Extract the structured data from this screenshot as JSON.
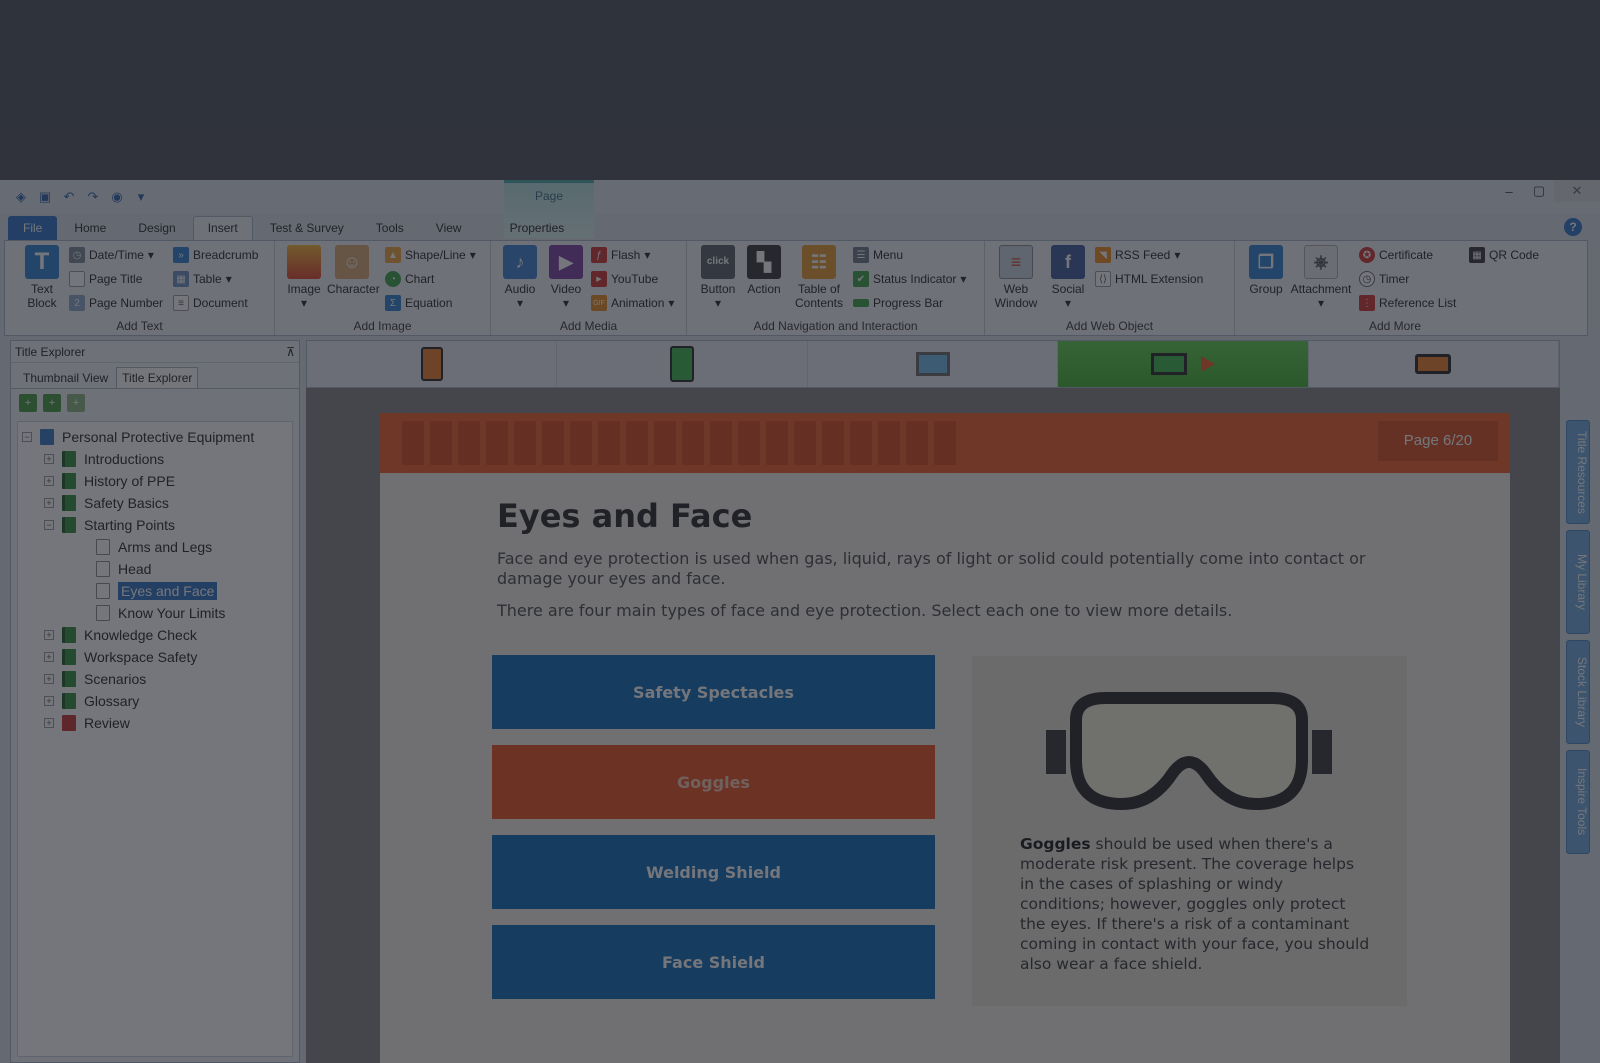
{
  "app": {
    "context_tab": "Page",
    "window_controls": {
      "minimize": "–",
      "maximize": "▢",
      "close": "✕"
    }
  },
  "tabs": [
    {
      "label": "File"
    },
    {
      "label": "Home"
    },
    {
      "label": "Design"
    },
    {
      "label": "Insert"
    },
    {
      "label": "Test & Survey"
    },
    {
      "label": "Tools"
    },
    {
      "label": "View"
    },
    {
      "label": "Properties"
    }
  ],
  "ribbon": {
    "add_text": {
      "group_label": "Add Text",
      "text_block": "Text Block",
      "date_time": "Date/Time",
      "page_title": "Page Title",
      "page_number": "Page Number",
      "breadcrumb": "Breadcrumb",
      "table": "Table",
      "document": "Document"
    },
    "add_image": {
      "group_label": "Add Image",
      "image": "Image",
      "character": "Character",
      "shape_line": "Shape/Line",
      "chart": "Chart",
      "equation": "Equation"
    },
    "add_media": {
      "group_label": "Add Media",
      "audio": "Audio",
      "video": "Video",
      "flash": "Flash",
      "youtube": "YouTube",
      "animation": "Animation"
    },
    "add_nav": {
      "group_label": "Add Navigation and Interaction",
      "button": "Button",
      "action": "Action",
      "toc": "Table of Contents",
      "menu": "Menu",
      "status_indicator": "Status Indicator",
      "progress_bar": "Progress Bar"
    },
    "add_web": {
      "group_label": "Add Web Object",
      "web_window": "Web Window",
      "social": "Social",
      "rss_feed": "RSS Feed",
      "html_extension": "HTML Extension"
    },
    "add_more": {
      "group_label": "Add More",
      "group": "Group",
      "attachment": "Attachment",
      "certificate": "Certificate",
      "timer": "Timer",
      "reference_list": "Reference List",
      "qr_code": "QR Code"
    }
  },
  "explorer": {
    "title": "Title Explorer",
    "pin": "⊼",
    "tabs": [
      "Thumbnail View",
      "Title Explorer"
    ],
    "tree": [
      {
        "label": "Personal Protective Equipment",
        "level": 0,
        "type": "root",
        "exp": "−"
      },
      {
        "label": "Introductions",
        "level": 1,
        "type": "book",
        "exp": "+"
      },
      {
        "label": "History of PPE",
        "level": 1,
        "type": "book",
        "exp": "+"
      },
      {
        "label": "Safety Basics",
        "level": 1,
        "type": "book",
        "exp": "+"
      },
      {
        "label": "Starting Points",
        "level": 1,
        "type": "book",
        "exp": "−"
      },
      {
        "label": "Arms and Legs",
        "level": 2,
        "type": "page"
      },
      {
        "label": "Head",
        "level": 2,
        "type": "page"
      },
      {
        "label": "Eyes and Face",
        "level": 2,
        "type": "page",
        "selected": true
      },
      {
        "label": "Know Your Limits",
        "level": 2,
        "type": "page"
      },
      {
        "label": "Knowledge Check",
        "level": 1,
        "type": "book",
        "exp": "+"
      },
      {
        "label": "Workspace Safety",
        "level": 1,
        "type": "book",
        "exp": "+"
      },
      {
        "label": "Scenarios",
        "level": 1,
        "type": "book",
        "exp": "+"
      },
      {
        "label": "Glossary",
        "level": 1,
        "type": "book",
        "exp": "+"
      },
      {
        "label": "Review",
        "level": 1,
        "type": "review",
        "exp": "+"
      }
    ]
  },
  "slide": {
    "page_number": "Page 6/20",
    "title": "Eyes and Face",
    "paragraph1": "Face and eye protection is used when gas, liquid, rays of light or solid could potentially come into contact or damage your eyes and face.",
    "paragraph2": "There are four main types of face and eye protection. Select each one to view more details.",
    "options": [
      "Safety Spectacles",
      "Goggles",
      "Welding Shield",
      "Face Shield"
    ],
    "selected_option": "Goggles",
    "detail_bold": "Goggles",
    "detail_text": " should be used when there's a moderate risk present. The coverage helps in the cases of splashing or windy conditions; however, goggles only protect the eyes. If there's a risk of a contaminant coming in contact with your face, you should also wear a face shield.",
    "colors": {
      "header": "#ee5a24",
      "option_blue": "#0a67b5",
      "option_active": "#ea4f1e"
    }
  },
  "side_tabs": [
    "Title Resources",
    "My Library",
    "Stock Library",
    "Inspire Tools"
  ]
}
